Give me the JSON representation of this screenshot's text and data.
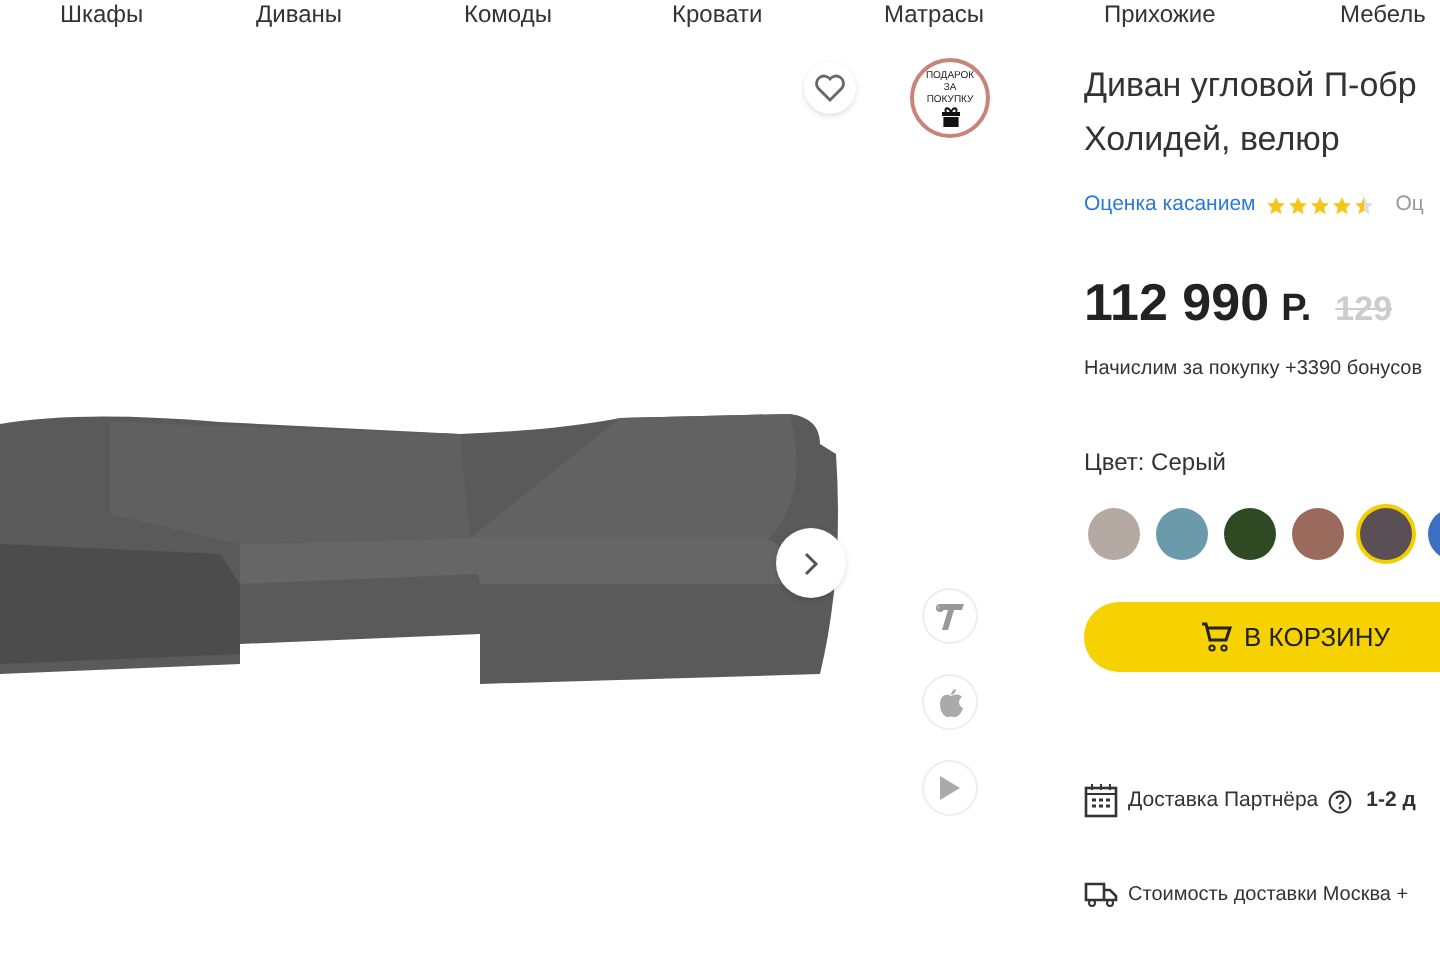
{
  "nav": [
    {
      "label": "Шкафы"
    },
    {
      "label": "Диваны"
    },
    {
      "label": "Комоды"
    },
    {
      "label": "Кровати"
    },
    {
      "label": "Матрасы"
    },
    {
      "label": "Прихожие"
    },
    {
      "label": "Мебель"
    }
  ],
  "gift_badge": {
    "text": "ПОДАРОК ЗА ПОКУПКУ"
  },
  "product": {
    "title_lines": [
      "Диван угловой П-обр",
      "Холидей, велюр"
    ],
    "rating": {
      "label": "Оценка касанием",
      "stars": 4.5,
      "reviews": "Оц"
    },
    "price": {
      "amount": "112 990",
      "currency": "Р.",
      "old": "129"
    },
    "bonus": "Начислим за покупку +3390 бонусов",
    "color_label": "Цвет: Серый",
    "swatches": [
      {
        "color": "#b4a9a3",
        "selected": false
      },
      {
        "color": "#6b9aab",
        "selected": false
      },
      {
        "color": "#2f4a22",
        "selected": false
      },
      {
        "color": "#9a6a5c",
        "selected": false
      },
      {
        "color": "#5a4f55",
        "selected": true
      },
      {
        "color": "#3b6fc0",
        "selected": false
      }
    ],
    "cart_button": "В КОРЗИНУ",
    "delivery": {
      "label": "Доставка Партнёра",
      "term": "1-2 д"
    },
    "delivery_cost": "Стоимость доставки Москва +"
  }
}
